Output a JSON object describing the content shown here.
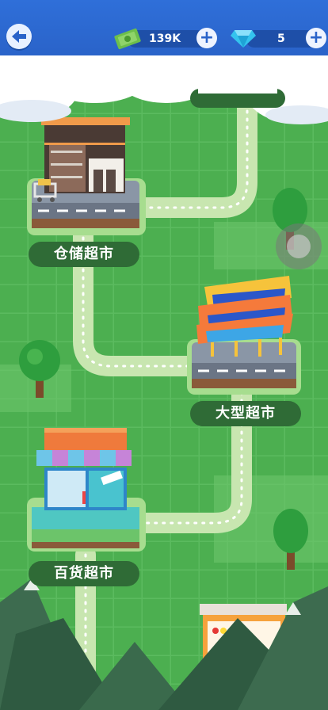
{
  "header": {
    "cash_value": "139K",
    "gems_value": "5"
  },
  "shops": [
    {
      "label": "仓储超市"
    },
    {
      "label": "大型超市"
    },
    {
      "label": "百货超市"
    }
  ],
  "colors": {
    "header_blue": "#2a63c9",
    "grass": "#4caf50",
    "path": "#c8e6b0",
    "label_bg": "#2f6b36"
  }
}
